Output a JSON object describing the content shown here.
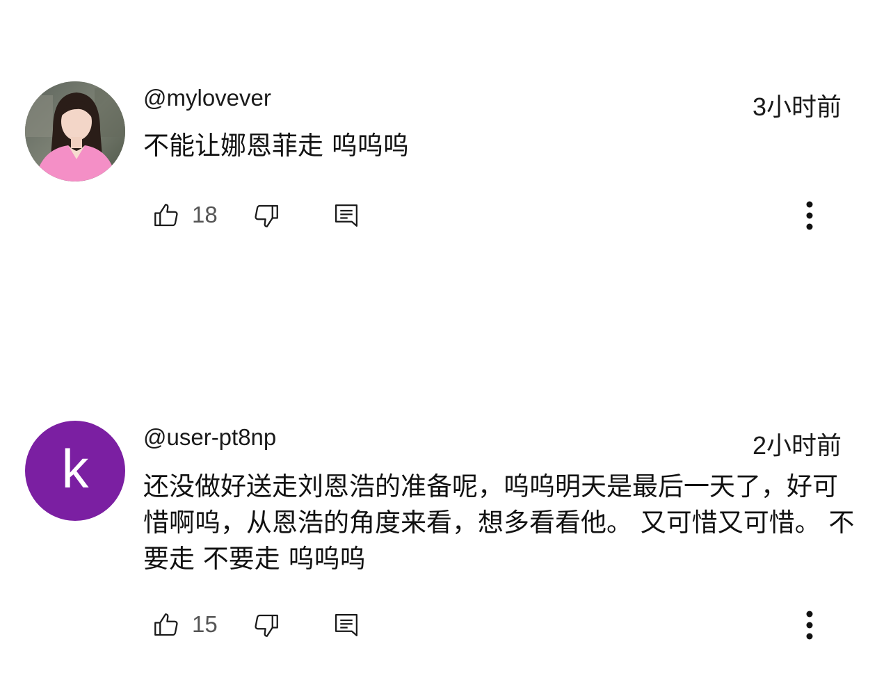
{
  "comments": [
    {
      "author": "@mylovever",
      "time": "3小时前",
      "text": "不能让娜恩菲走 呜呜呜",
      "likes": "18",
      "avatar_type": "photo"
    },
    {
      "author": "@user-pt8np",
      "time": "2小时前",
      "text": "还没做好送走刘恩浩的准备呢，呜呜明天是最后一天了，好可惜啊呜，从恩浩的角度来看，想多看看他。 又可惜又可惜。 不要走 不要走 呜呜呜",
      "likes": "15",
      "avatar_type": "letter",
      "avatar_letter": "k",
      "avatar_color": "#7b1fa2"
    }
  ],
  "icons": {
    "like": "thumb-up-icon",
    "dislike": "thumb-down-icon",
    "reply": "comment-icon",
    "more": "more-vertical-icon"
  }
}
